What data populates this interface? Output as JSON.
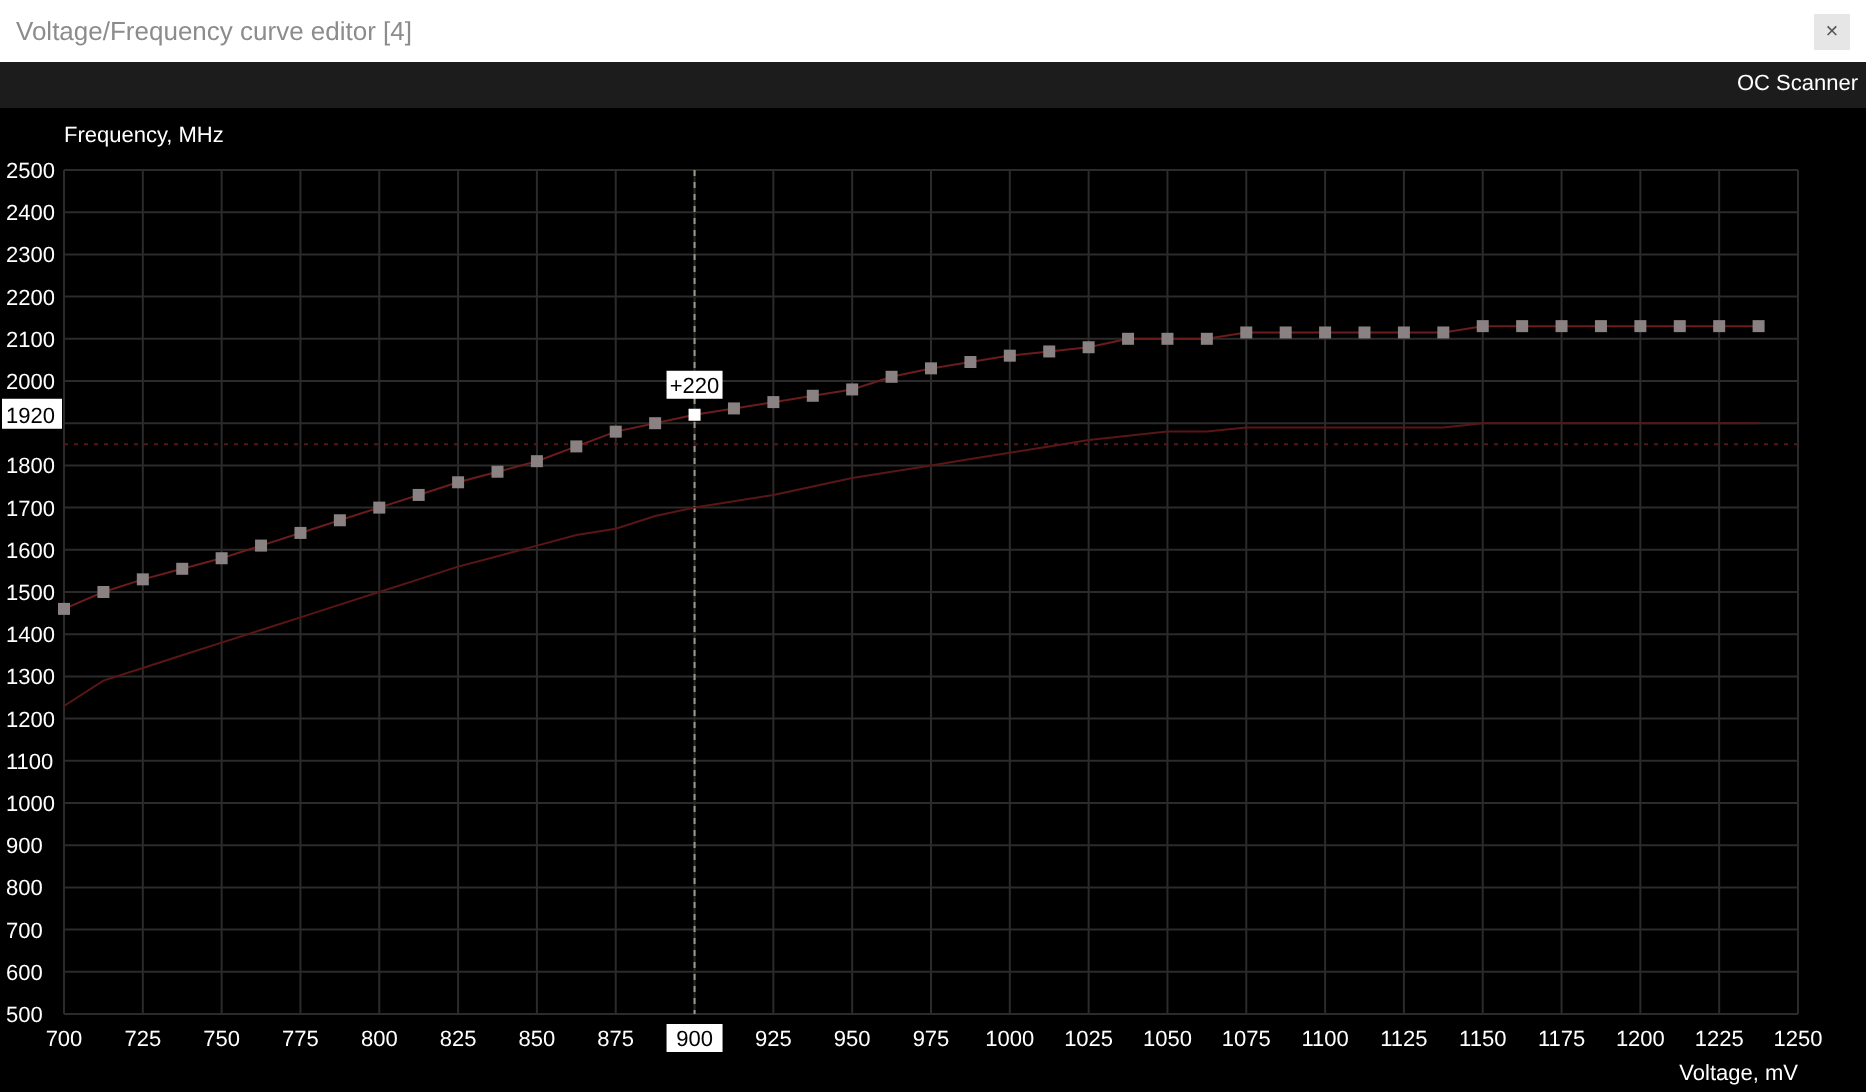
{
  "window": {
    "title": "Voltage/Frequency curve editor [4]",
    "close_label": "×"
  },
  "toolbar": {
    "buttons": [
      "OC Scanner"
    ]
  },
  "chart_data": {
    "type": "line",
    "xlabel": "Voltage, mV",
    "ylabel": "Frequency, MHz",
    "xlim": [
      700,
      1250
    ],
    "ylim": [
      500,
      2500
    ],
    "xticks": [
      700,
      725,
      750,
      775,
      800,
      825,
      850,
      875,
      925,
      950,
      975,
      1000,
      1025,
      1050,
      1075,
      1100,
      1125,
      1150,
      1175,
      1200,
      1225,
      1250
    ],
    "yticks": [
      500,
      600,
      700,
      800,
      900,
      1000,
      1100,
      1200,
      1300,
      1400,
      1500,
      1600,
      1700,
      1800,
      2000,
      2100,
      2200,
      2300,
      2400,
      2500
    ],
    "x": [
      700,
      712.5,
      725,
      737.5,
      750,
      762.5,
      775,
      787.5,
      800,
      812.5,
      825,
      837.5,
      850,
      862.5,
      875,
      887.5,
      900,
      912.5,
      925,
      937.5,
      950,
      962.5,
      975,
      987.5,
      1000,
      1012.5,
      1025,
      1037.5,
      1050,
      1062.5,
      1075,
      1087.5,
      1100,
      1112.5,
      1125,
      1137.5,
      1150,
      1162.5,
      1175,
      1187.5,
      1200,
      1212.5,
      1225,
      1237.5
    ],
    "series": [
      {
        "color": "#8a8282",
        "marker": "square",
        "values": [
          1460,
          1500,
          1530,
          1555,
          1580,
          1610,
          1640,
          1670,
          1700,
          1730,
          1760,
          1785,
          1810,
          1845,
          1880,
          1900,
          1920,
          1935,
          1950,
          1965,
          1980,
          2010,
          2030,
          2045,
          2060,
          2070,
          2080,
          2100,
          2100,
          2100,
          2115,
          2115,
          2115,
          2115,
          2115,
          2115,
          2130,
          2130,
          2130,
          2130,
          2130,
          2130,
          2130,
          2130
        ]
      },
      {
        "color": "#5a1616",
        "values": [
          1230,
          1290,
          1320,
          1350,
          1380,
          1410,
          1440,
          1470,
          1500,
          1530,
          1560,
          1585,
          1610,
          1635,
          1650,
          1680,
          1700,
          1715,
          1730,
          1750,
          1770,
          1785,
          1800,
          1815,
          1830,
          1845,
          1860,
          1870,
          1880,
          1880,
          1890,
          1890,
          1890,
          1890,
          1890,
          1890,
          1900,
          1900,
          1900,
          1900,
          1900,
          1900,
          1900,
          1900
        ]
      }
    ],
    "grid": true,
    "ref_lines": [
      {
        "axis": "y",
        "value": 1850,
        "color": "#5a1616"
      },
      {
        "axis": "x",
        "value": 900,
        "color": "#9a9a8a"
      }
    ],
    "annotations": [
      {
        "x": 900,
        "y": 1920,
        "text": "+220"
      }
    ]
  },
  "cursor": {
    "voltage_label": "900",
    "frequency_label": "1920"
  }
}
